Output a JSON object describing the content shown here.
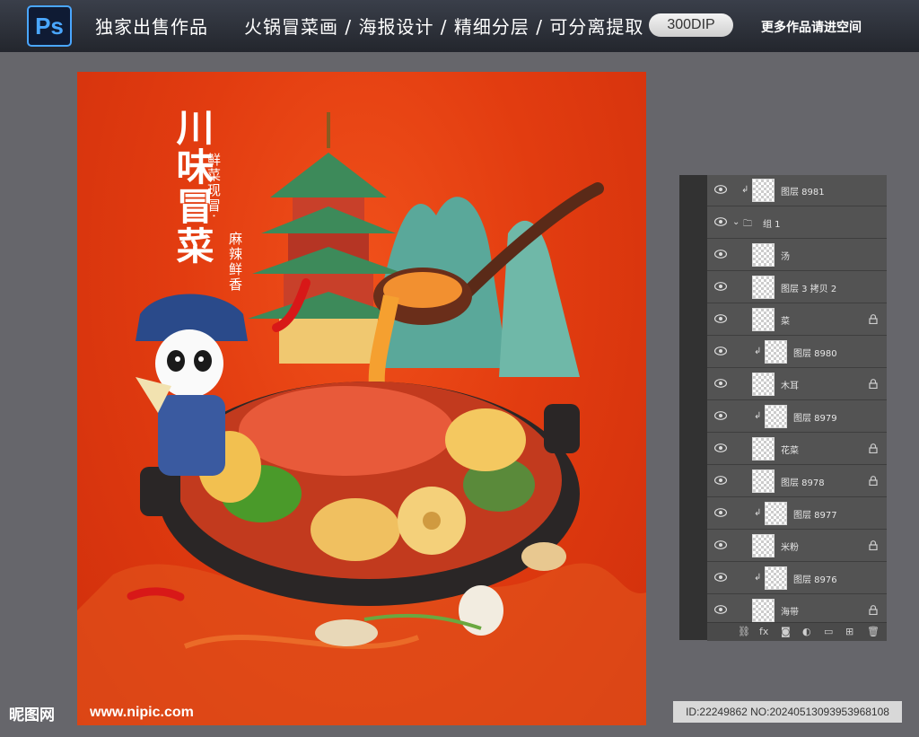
{
  "banner": {
    "app_badge": "Ps",
    "title_left": "独家出售作品",
    "title_main": "火锅冒菜画 / 海报设计 / 精细分层 / 可分离提取",
    "dpi": "300DIP",
    "more": "更多作品请进空间"
  },
  "poster": {
    "title": "川味冒菜",
    "subtitle_1": "鲜菜现冒·",
    "subtitle_2": "麻辣鲜香",
    "background_color": "#e23c10"
  },
  "layers_panel": {
    "layers": [
      {
        "name": "图层 8981",
        "clipped": true,
        "locked": false,
        "indent": 1
      },
      {
        "name": "组 1",
        "is_group": true,
        "locked": false,
        "indent": 0
      },
      {
        "name": "汤",
        "clipped": false,
        "locked": false,
        "indent": 1
      },
      {
        "name": "图层 3 拷贝 2",
        "clipped": false,
        "locked": false,
        "indent": 1
      },
      {
        "name": "菜",
        "clipped": false,
        "locked": true,
        "indent": 1
      },
      {
        "name": "图层 8980",
        "clipped": true,
        "locked": false,
        "indent": 2
      },
      {
        "name": "木耳",
        "clipped": false,
        "locked": true,
        "indent": 1
      },
      {
        "name": "图层 8979",
        "clipped": true,
        "locked": false,
        "indent": 2
      },
      {
        "name": "花菜",
        "clipped": false,
        "locked": true,
        "indent": 1
      },
      {
        "name": "图层 8978",
        "clipped": false,
        "locked": true,
        "indent": 1
      },
      {
        "name": "图层 8977",
        "clipped": true,
        "locked": false,
        "indent": 2
      },
      {
        "name": "米粉",
        "clipped": false,
        "locked": true,
        "indent": 1
      },
      {
        "name": "图层 8976",
        "clipped": true,
        "locked": false,
        "indent": 2
      },
      {
        "name": "海带",
        "clipped": false,
        "locked": true,
        "indent": 1
      }
    ],
    "footer_icons": [
      "link-icon",
      "fx-icon",
      "mask-icon",
      "adjustment-icon",
      "folder-icon",
      "new-layer-icon",
      "trash-icon"
    ],
    "footer_glyphs": [
      "⛓",
      "fx",
      "◙",
      "◐",
      "▭",
      "⊞",
      "🗑"
    ]
  },
  "watermark": {
    "site_cn": "昵图网",
    "site_url": "www.nipic.com",
    "id_text": "ID:22249862 NO:20240513093953968108"
  }
}
